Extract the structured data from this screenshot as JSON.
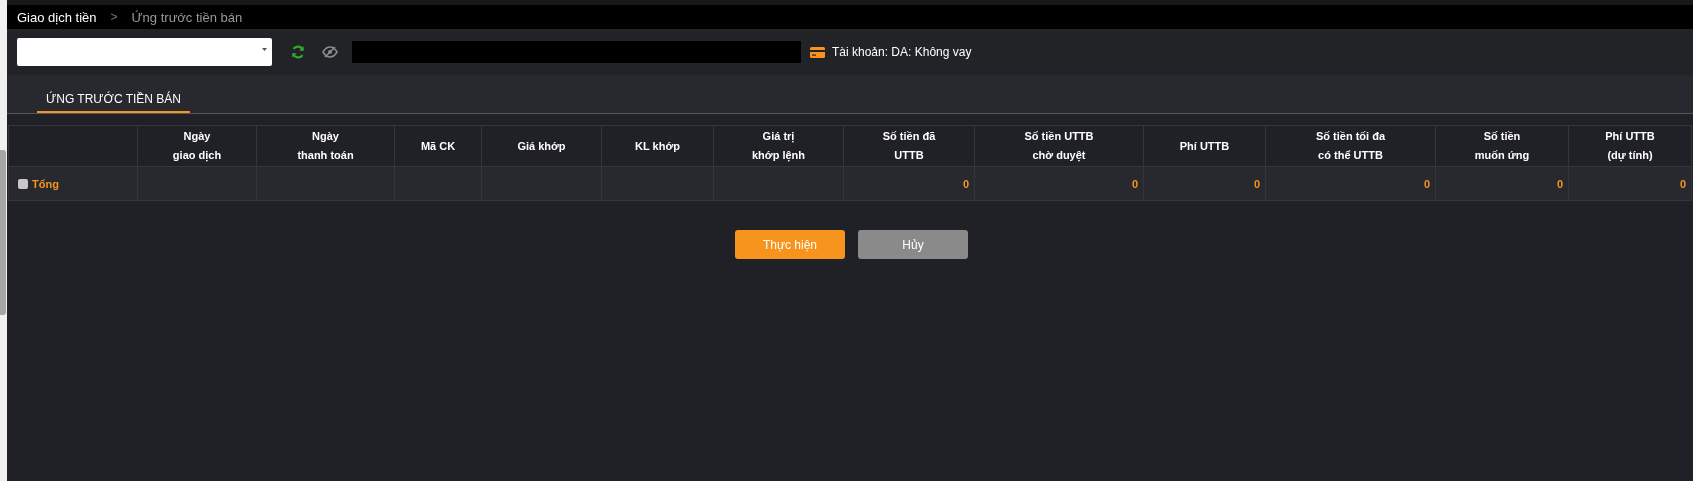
{
  "breadcrumb": [
    {
      "label": "Giao dịch tiền",
      "current": false
    },
    {
      "label": "Ứng trước tiền bán",
      "current": true
    }
  ],
  "separator": ">",
  "toolbar": {
    "account_select": {
      "kind": "dropdown"
    },
    "account_info": "Tài khoản: DA: Không vay"
  },
  "tabs": [
    {
      "label": "ỨNG TRƯỚC TIỀN BÁN",
      "selected": true
    }
  ],
  "table": {
    "columns": [
      null,
      "Ngày\ngiao dịch",
      "Ngày\nthanh toán",
      "Mã CK",
      "Giá khớp",
      "KL khớp",
      "Giá trị\nkhớp lệnh",
      "Số tiền đã\nUTTB",
      "Số tiền UTTB\nchờ duyệt",
      "Phí UTTB",
      "Số tiền tối đa\ncó thể UTTB",
      "Số tiền\nmuốn ứng",
      "Phí UTTB\n(dự tính)"
    ],
    "rows": [
      {
        "checked": false,
        "cells": [
          "Tổng",
          "",
          "",
          "",
          "",
          "",
          "",
          "0",
          "0",
          "0",
          "0",
          "0",
          "0"
        ]
      }
    ]
  },
  "buttons": [
    {
      "label": "Thực hiện",
      "kind": "primary"
    },
    {
      "label": "Hủy",
      "kind": "secondary"
    }
  ]
}
